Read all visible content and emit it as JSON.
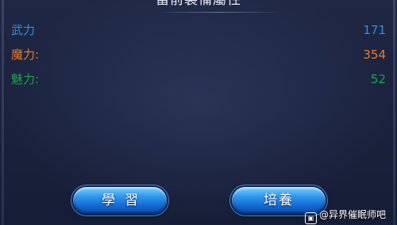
{
  "panel": {
    "title": "當前裝備屬性"
  },
  "stats": [
    {
      "label": "武力",
      "value": "171",
      "color": "#2f8fd6"
    },
    {
      "label": "魔力:",
      "value": "354",
      "color": "#f07a2a"
    },
    {
      "label": "魅力:",
      "value": "52",
      "color": "#1fa24a"
    }
  ],
  "buttons": {
    "learn_label": "學習",
    "train_label": "培養"
  },
  "watermark": {
    "text": "@异界催眠师吧"
  }
}
